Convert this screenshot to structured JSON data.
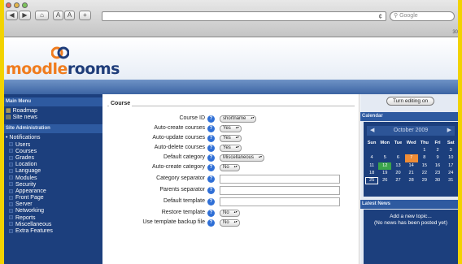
{
  "browser": {
    "back": "◀",
    "forward": "▶",
    "home": "⌂",
    "text_smaller": "A",
    "text_larger": "A",
    "add": "+",
    "search_placeholder": "Google",
    "reload": "¢",
    "tab_count": "30"
  },
  "site": {
    "logo_text_1": "moodle",
    "logo_text_2": "rooms"
  },
  "left": {
    "main_menu_title": "Main Menu",
    "main_menu_items": [
      "Roadmap",
      "Site news"
    ],
    "admin_title": "Site Administration",
    "admin_items": [
      "Notifications",
      "Users",
      "Courses",
      "Grades",
      "Location",
      "Language",
      "Modules",
      "Security",
      "Appearance",
      "Front Page",
      "Server",
      "Networking",
      "Reports",
      "Miscellaneous",
      "Extra Features"
    ]
  },
  "form": {
    "legend": "Course",
    "rows": [
      {
        "label": "Course ID",
        "type": "select",
        "value": "shortname"
      },
      {
        "label": "Auto-create courses",
        "type": "select",
        "value": "Yes"
      },
      {
        "label": "Auto-update courses",
        "type": "select",
        "value": "Yes"
      },
      {
        "label": "Auto-delete courses",
        "type": "select",
        "value": "Yes"
      },
      {
        "label": "Default category",
        "type": "select",
        "value": "Miscellaneous"
      },
      {
        "label": "Auto-create category",
        "type": "select",
        "value": "No"
      },
      {
        "label": "Category separator",
        "type": "text",
        "value": ""
      },
      {
        "label": "Parents separator",
        "type": "text",
        "value": ""
      },
      {
        "label": "Default template",
        "type": "text",
        "value": ""
      },
      {
        "label": "Restore template",
        "type": "select",
        "value": "No"
      },
      {
        "label": "Use template backup file",
        "type": "select",
        "value": "No"
      }
    ],
    "help_glyph": "?"
  },
  "right": {
    "edit_button": "Turn editing on",
    "calendar_title": "Calendar",
    "month": "October 2009",
    "prev": "◀",
    "next": "▶",
    "weekdays": [
      "Sun",
      "Mon",
      "Tue",
      "Wed",
      "Thu",
      "Fri",
      "Sat"
    ],
    "weeks": [
      [
        "",
        "",
        "",
        "",
        "1",
        "2",
        "3"
      ],
      [
        "4",
        "5",
        "6",
        "7",
        "8",
        "9",
        "10"
      ],
      [
        "11",
        "12",
        "13",
        "14",
        "15",
        "16",
        "17"
      ],
      [
        "18",
        "19",
        "20",
        "21",
        "22",
        "23",
        "24"
      ],
      [
        "25",
        "26",
        "27",
        "28",
        "29",
        "30",
        "31"
      ]
    ],
    "today": "7",
    "event_day": "12",
    "boxed_day": "25",
    "news_title": "Latest News",
    "news_link": "Add a new topic...",
    "news_empty": "(No news has been posted yet)"
  },
  "colors": {
    "accent_yellow": "#f5d400",
    "nav_dark_blue": "#1c3f7d",
    "help_blue": "#2f6fd6",
    "today_orange": "#f08c35",
    "event_green": "#3aa44b",
    "logo_orange": "#f07c1e",
    "logo_blue": "#1f3d7a"
  }
}
